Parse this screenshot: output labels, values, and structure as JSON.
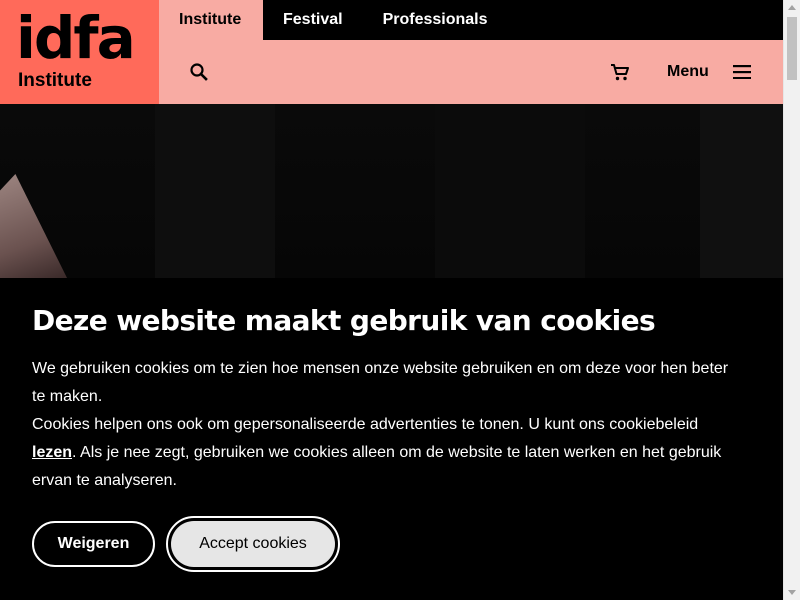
{
  "brand": {
    "logo_text": "idfa",
    "sub_label": "Institute",
    "block_color": "#ff6a5a"
  },
  "nav": {
    "tabs": [
      {
        "label": "Institute",
        "active": true
      },
      {
        "label": "Festival",
        "active": false
      },
      {
        "label": "Professionals",
        "active": false
      }
    ],
    "toolbar_color": "#f8aba3",
    "search_icon": "search-icon",
    "cart_icon": "cart-icon",
    "menu_label": "Menu",
    "menu_icon": "hamburger-icon"
  },
  "cookie_banner": {
    "title": "Deze website maakt gebruik van cookies",
    "paragraph_1": "We gebruiken cookies om te zien hoe mensen onze website gebruiken en om deze voor hen beter te maken.",
    "paragraph_2_before": "Cookies helpen ons ook om gepersonaliseerde advertenties te tonen. U kunt ons cookiebeleid ",
    "paragraph_2_link": "lezen",
    "paragraph_2_after": ". Als je nee zegt, gebruiken we cookies alleen om de website te laten werken en het gebruik ervan te analyseren.",
    "decline_label": "Weigeren",
    "accept_label": "Accept cookies"
  }
}
